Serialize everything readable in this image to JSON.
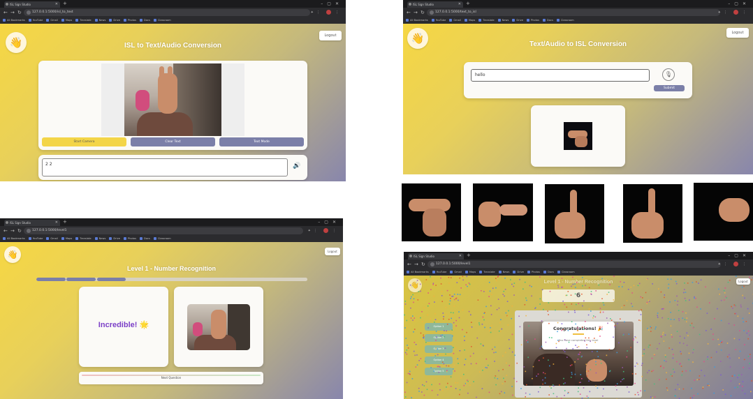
{
  "s1": {
    "tab_title": "ISL Sign Studio",
    "url": "127.0.0.1:5000/isl_to_text",
    "bookmarks": [
      "All Bookmarks",
      "YouTube",
      "Gmail",
      "Maps",
      "Translate",
      "News",
      "Drive",
      "Photos",
      "Docs",
      "Classroom"
    ],
    "logout_label": "Logout",
    "title": "ISL to Text/Audio Conversion",
    "buttons": [
      "Start Camera",
      "Clear Text",
      "Text Mode"
    ],
    "output_text": "2 2"
  },
  "s2": {
    "tab_title": "ISL Sign Studio",
    "url": "127.0.0.1:5000/text_to_isl",
    "bookmarks": [
      "All Bookmarks",
      "YouTube",
      "Gmail",
      "Maps",
      "Translate",
      "News",
      "Drive",
      "Photos",
      "Docs",
      "Classroom"
    ],
    "logout_label": "Logout",
    "title": "Text/Audio to ISL Conversion",
    "input_value": "hello",
    "submit_label": "Submit"
  },
  "s3": {
    "tab_title": "ISL Sign Studio",
    "url": "127.0.0.1:5000/level1",
    "bookmarks": [
      "All Bookmarks",
      "YouTube",
      "Gmail",
      "Maps",
      "Translate",
      "News",
      "Drive",
      "Photos",
      "Docs",
      "Classroom"
    ],
    "logout_label": "Logout",
    "title": "Level 1 - Number Recognition",
    "progress_done": 3,
    "progress_total": 9,
    "feedback": "Incredible! 🌟",
    "bar_label": "Next Question"
  },
  "s4": {
    "tab_title": "ISL Sign Studio",
    "url": "127.0.0.1:5000/level1",
    "bookmarks": [
      "All Bookmarks",
      "YouTube",
      "Gmail",
      "Maps",
      "Translate",
      "News",
      "Drive",
      "Photos",
      "Docs",
      "Classroom"
    ],
    "logout_label": "Logout",
    "title": "Level 1 - Number Recognition",
    "number": "6",
    "options": [
      "Option 1",
      "Option 2",
      "Option 3",
      "Option 4",
      "Option 5"
    ],
    "popup_title": "Congratulations! 🎉",
    "popup_sub": "You have completed this level"
  },
  "colors": {
    "accent_yellow": "#f6d743",
    "accent_purple": "#7b7fa8",
    "gradient_end": "#8886ac"
  }
}
